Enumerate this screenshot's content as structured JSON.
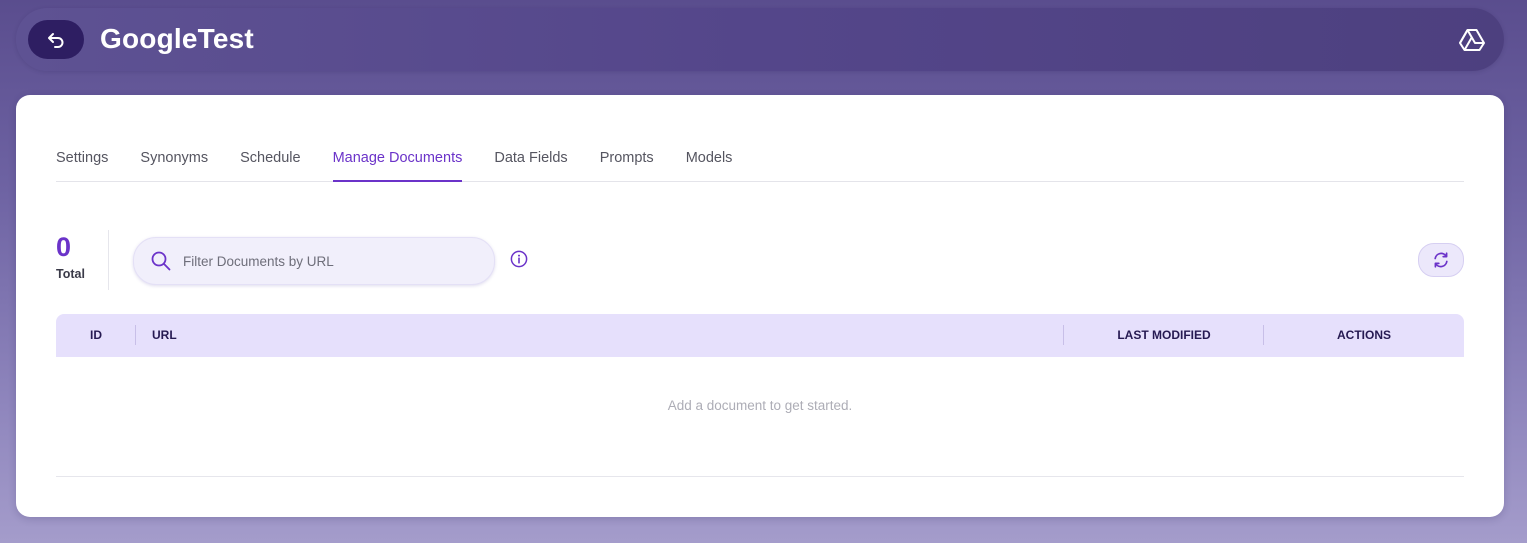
{
  "header": {
    "title": "GoogleTest",
    "back_icon": "arrow-undo-icon",
    "source_icon": "google-drive-icon"
  },
  "tabs": [
    {
      "label": "Settings",
      "active": false
    },
    {
      "label": "Synonyms",
      "active": false
    },
    {
      "label": "Schedule",
      "active": false
    },
    {
      "label": "Manage Documents",
      "active": true
    },
    {
      "label": "Data Fields",
      "active": false
    },
    {
      "label": "Prompts",
      "active": false
    },
    {
      "label": "Models",
      "active": false
    }
  ],
  "summary": {
    "total_count": "0",
    "total_label": "Total"
  },
  "search": {
    "placeholder": "Filter Documents by URL",
    "value": ""
  },
  "table": {
    "columns": [
      "ID",
      "URL",
      "LAST MODIFIED",
      "ACTIONS"
    ],
    "rows": [],
    "empty_message": "Add a document to get started."
  },
  "colors": {
    "accent": "#6b33c9",
    "header_bg": "#54468a",
    "back_button_bg": "#2e1e62",
    "table_header_bg": "#e6e0fc"
  }
}
